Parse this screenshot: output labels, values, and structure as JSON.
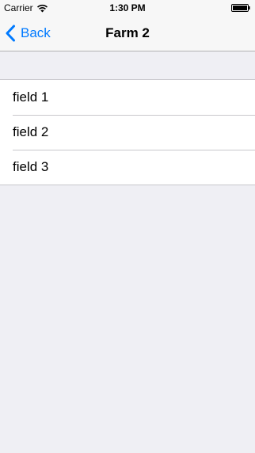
{
  "status_bar": {
    "carrier": "Carrier",
    "time": "1:30 PM",
    "wifi_icon": "wifi-icon",
    "battery_icon": "battery-icon"
  },
  "nav": {
    "back_label": "Back",
    "back_icon": "chevron-left-icon",
    "title": "Farm 2"
  },
  "list": {
    "items": [
      {
        "label": "field 1"
      },
      {
        "label": "field 2"
      },
      {
        "label": "field 3"
      }
    ]
  },
  "colors": {
    "accent": "#007aff",
    "background": "#efeff4",
    "bar": "#f7f7f7",
    "separator": "#c8c7cc"
  }
}
